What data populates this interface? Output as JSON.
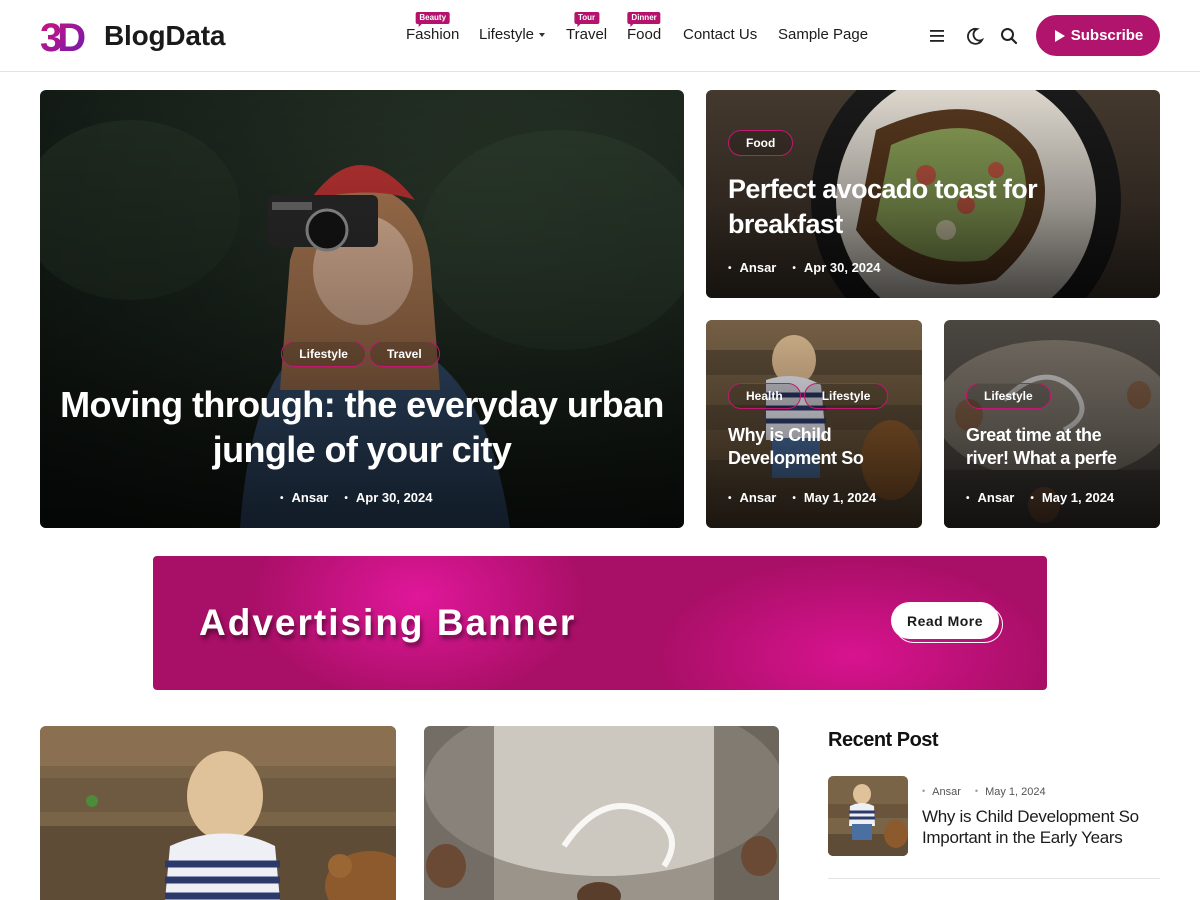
{
  "site": {
    "logo_mark": "3D",
    "logo_text": "BlogData"
  },
  "nav": {
    "items": [
      {
        "label": "Fashion",
        "badge": "Beauty"
      },
      {
        "label": "Lifestyle",
        "badge": ""
      },
      {
        "label": "Travel",
        "badge": "Tour"
      },
      {
        "label": "Food",
        "badge": "Dinner"
      },
      {
        "label": "Contact Us",
        "badge": ""
      },
      {
        "label": "Sample Page",
        "badge": ""
      }
    ],
    "icons": [
      "menu-icon",
      "moon-icon",
      "search-icon"
    ],
    "subscribe_label": "Subscribe"
  },
  "colors": {
    "accent": "#b0146c",
    "banner": "#a80f66"
  },
  "hero": {
    "tags": [
      "Lifestyle",
      "Travel"
    ],
    "title_line1": "Moving through: the everyday urban",
    "title_line2": "jungle of your city",
    "author": "Ansar",
    "date": "Apr 30, 2024"
  },
  "side_top": {
    "tag": "Food",
    "title_line1": "Perfect avocado toast for",
    "title_line2": "breakfast",
    "author": "Ansar",
    "date": "Apr 30, 2024"
  },
  "side_left": {
    "tags": [
      "Health",
      "Lifestyle"
    ],
    "title_line1": "Why is Child",
    "title_line2": "Development So",
    "author": "Ansar",
    "date": "May 1, 2024"
  },
  "side_right": {
    "tag": "Lifestyle",
    "title_line1": "Great time at the",
    "title_line2": "river! What a perfe",
    "author": "Ansar",
    "date": "May 1, 2024"
  },
  "banner": {
    "text": "Advertising Banner",
    "button": "Read More"
  },
  "recent": {
    "heading": "Recent Post",
    "items": [
      {
        "author": "Ansar",
        "date": "May 1, 2024",
        "title": "Why is Child Development So Important in the Early Years"
      }
    ]
  }
}
